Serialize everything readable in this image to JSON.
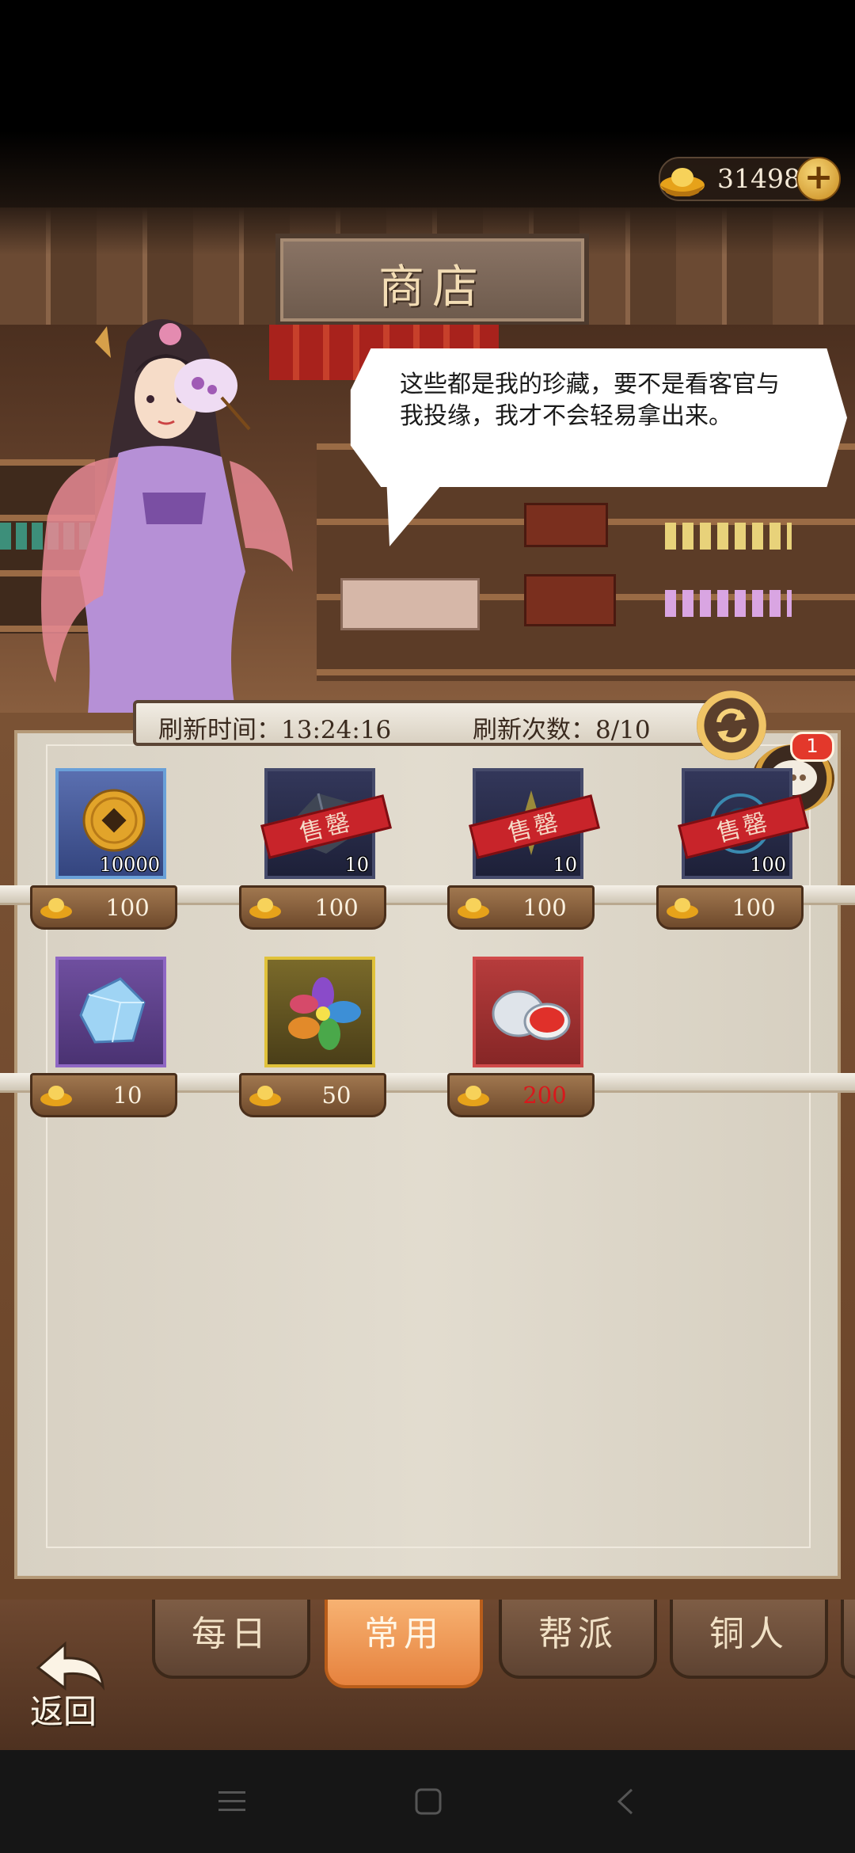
{
  "currency": {
    "amount": "31498"
  },
  "title": "商店",
  "dialogue": "这些都是我的珍藏，要不是看客官与我投缘，我才不会轻易拿出来。",
  "refresh": {
    "time_label": "刷新时间：13:24:16",
    "count_label": "刷新次数：8/10"
  },
  "chat": {
    "badge": "1"
  },
  "items": [
    {
      "name": "copper-coin",
      "quantity": "10000",
      "price": "100",
      "sold_out": false,
      "sold_label": ""
    },
    {
      "name": "ore",
      "quantity": "10",
      "price": "100",
      "sold_out": true,
      "sold_label": "售罄"
    },
    {
      "name": "herb",
      "quantity": "10",
      "price": "100",
      "sold_out": true,
      "sold_label": "售罄"
    },
    {
      "name": "orb",
      "quantity": "100",
      "price": "100",
      "sold_out": true,
      "sold_label": "售罄"
    },
    {
      "name": "blue-gem",
      "quantity": "",
      "price": "10",
      "sold_out": false
    },
    {
      "name": "rainbow-flower",
      "quantity": "",
      "price": "50",
      "sold_out": false
    },
    {
      "name": "rouge-box",
      "quantity": "",
      "price": "200",
      "sold_out": false,
      "price_color": "#d8181c"
    }
  ],
  "tabs": [
    {
      "label": "每日",
      "active": false
    },
    {
      "label": "常用",
      "active": true
    },
    {
      "label": "帮派",
      "active": false
    },
    {
      "label": "铜人",
      "active": false
    }
  ],
  "back_label": "返回",
  "colors": {
    "accent": "#e6823e",
    "sold_out": "#c8242a",
    "price_highlight": "#d8181c"
  }
}
